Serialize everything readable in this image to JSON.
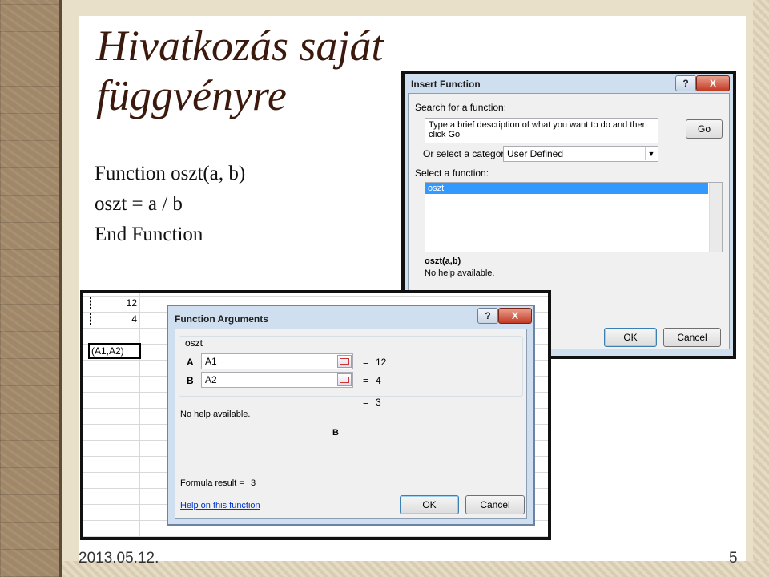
{
  "slide": {
    "title": "Hivatkozás saját függvényre",
    "code_lines": [
      "Function oszt(a, b)",
      "oszt = a / b",
      "End Function"
    ],
    "footer_date": "2013.05.12.",
    "page_number": "5"
  },
  "insert_dialog": {
    "title": "Insert Function",
    "help_btn": "?",
    "close_btn": "X",
    "search_label": "Search for a function:",
    "search_value": "Type a brief description of what you want to do and then click Go",
    "go_btn": "Go",
    "category_label": "Or select a category:",
    "category_value": "User Defined",
    "select_label": "Select a function:",
    "functions": [
      "oszt"
    ],
    "signature": "oszt(a,b)",
    "help_text": "No help available.",
    "ok_btn": "OK",
    "cancel_btn": "Cancel"
  },
  "excel": {
    "cells": [
      "12",
      "4"
    ],
    "formula_fragment": "(A1,A2)"
  },
  "args_dialog": {
    "title": "Function Arguments",
    "help_btn": "?",
    "close_btn": "X",
    "function_name": "oszt",
    "args": [
      {
        "name": "A",
        "value": "A1",
        "eq": "=",
        "result": "12"
      },
      {
        "name": "B",
        "value": "A2",
        "eq": "=",
        "result": "4"
      }
    ],
    "total_eq": "=",
    "total_result": "3",
    "help_text": "No help available.",
    "current_arg": "B",
    "formula_result_label": "Formula result =",
    "formula_result_value": "3",
    "help_link": "Help on this function",
    "ok_btn": "OK",
    "cancel_btn": "Cancel"
  },
  "colors": {
    "title": "#3b1a0d",
    "dialog_bg": "#cfdff0",
    "selection": "#3399ff",
    "link": "#0033cc"
  }
}
